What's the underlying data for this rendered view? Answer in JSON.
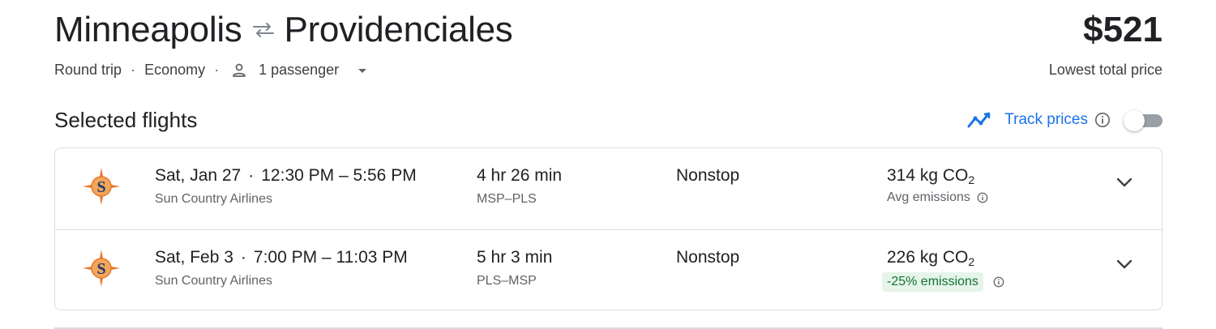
{
  "header": {
    "origin": "Minneapolis",
    "destination": "Providenciales",
    "price": "$521",
    "price_caption": "Lowest total price",
    "swap_icon": "swap-arrows-icon"
  },
  "trip_options": {
    "trip_type": "Round trip",
    "cabin": "Economy",
    "separator": "·",
    "passengers": "1 passenger"
  },
  "section": {
    "title": "Selected flights",
    "track_prices_label": "Track prices",
    "track_prices_on": false
  },
  "flights": [
    {
      "date": "Sat, Jan 27",
      "dot": "·",
      "times": "12:30 PM – 5:56 PM",
      "airline": "Sun Country Airlines",
      "duration": "4 hr 26 min",
      "route": "MSP–PLS",
      "stops": "Nonstop",
      "co2_value": "314 kg CO",
      "co2_sub": "2",
      "emissions_label": "Avg emissions"
    },
    {
      "date": "Sat, Feb 3",
      "dot": "·",
      "times": "7:00 PM – 11:03 PM",
      "airline": "Sun Country Airlines",
      "duration": "5 hr 3 min",
      "route": "PLS–MSP",
      "stops": "Nonstop",
      "co2_value": "226 kg CO",
      "co2_sub": "2",
      "emissions_label": "-25% emissions"
    }
  ],
  "colors": {
    "accent": "#1a73e8",
    "badge_bg": "#e6f4ea",
    "badge_text": "#137333",
    "logo_orange": "#e8772e",
    "logo_navy": "#1f3a6b"
  }
}
